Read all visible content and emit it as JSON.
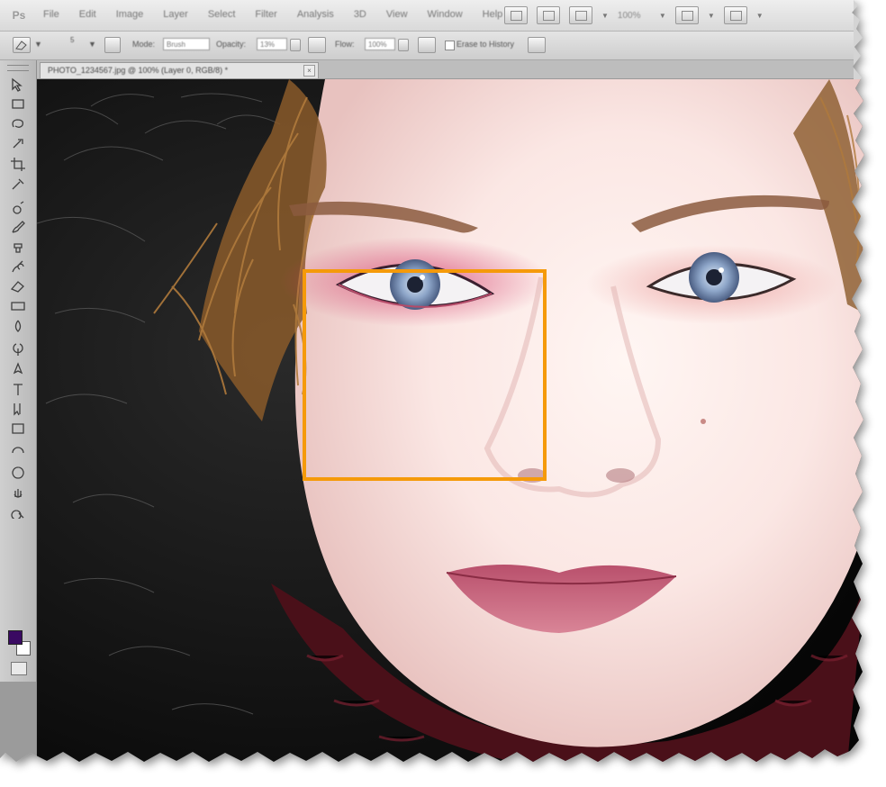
{
  "app": {
    "logo_text": "Ps"
  },
  "menu": [
    "File",
    "Edit",
    "Image",
    "Layer",
    "Select",
    "Filter",
    "Analysis",
    "3D",
    "View",
    "Window",
    "Help"
  ],
  "menubar_right": {
    "zoom": "100%"
  },
  "options": {
    "mode_label": "Mode:",
    "mode_value": "Brush",
    "opacity_label": "Opacity:",
    "opacity_value": "13%",
    "flow_label": "Flow:",
    "flow_value": "100%",
    "erase_to_history_label": "Erase to History",
    "brush_size": "5"
  },
  "document": {
    "tab_title": "PHOTO_1234567.jpg @ 100% (Layer 0, RGB/8) *",
    "close": "×"
  },
  "colors": {
    "highlight": "#f59a0a",
    "foreground": "#3a0a62",
    "background": "#ffffff"
  },
  "tools": [
    "move-icon",
    "marquee-icon",
    "lasso-icon",
    "quick-select-icon",
    "crop-icon",
    "eyedropper-icon",
    "spot-heal-icon",
    "brush-icon",
    "clone-stamp-icon",
    "history-brush-icon",
    "eraser-icon",
    "gradient-icon",
    "blur-icon",
    "dodge-icon",
    "pen-icon",
    "type-icon",
    "path-select-icon",
    "shape-icon",
    "3d-rotate-icon",
    "3d-orbit-icon",
    "hand-icon",
    "zoom-icon"
  ]
}
